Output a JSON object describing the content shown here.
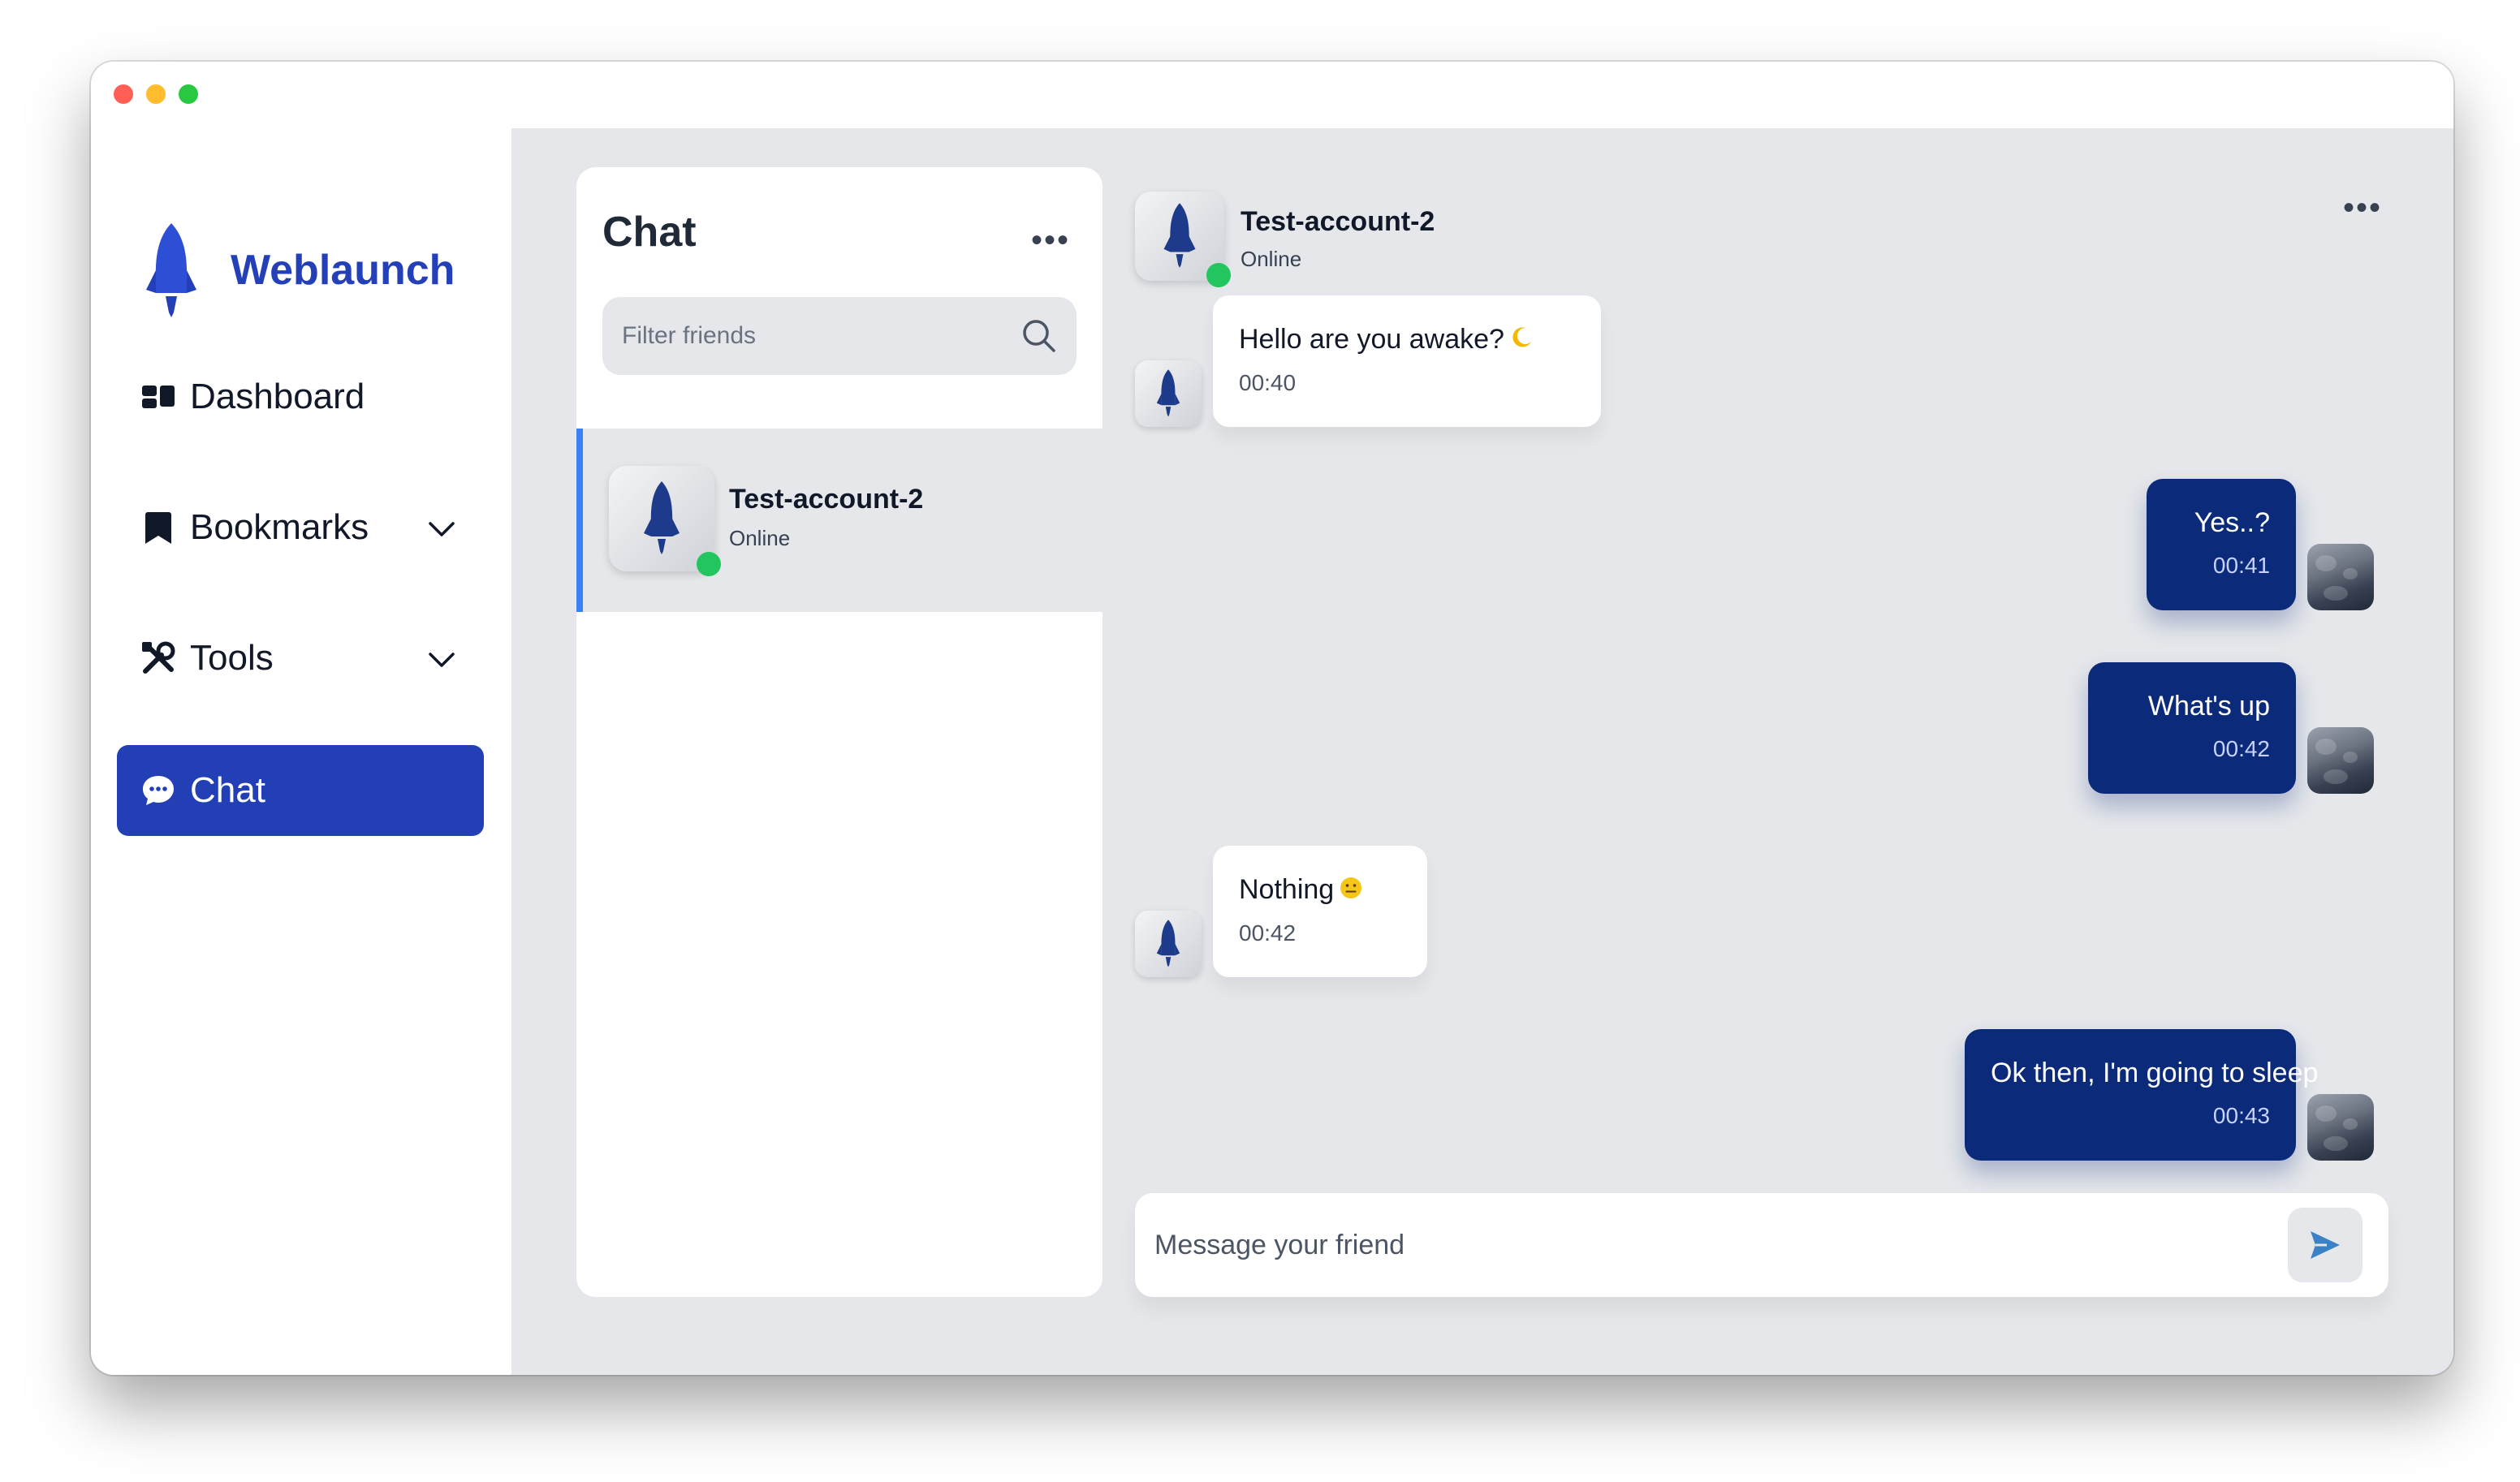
{
  "brand": {
    "name": "Weblaunch",
    "accent": "#2340b8"
  },
  "nav": {
    "items": [
      {
        "label": "Dashboard",
        "icon": "dashboard-icon"
      },
      {
        "label": "Bookmarks",
        "icon": "bookmark-icon",
        "expandable": true
      },
      {
        "label": "Tools",
        "icon": "tools-icon",
        "expandable": true
      },
      {
        "label": "Chat",
        "icon": "chat-bubble-icon",
        "active": true
      }
    ]
  },
  "friends_panel": {
    "title": "Chat",
    "more_icon": "ellipsis-icon",
    "search": {
      "placeholder": "Filter friends",
      "value": "",
      "icon": "search-icon"
    },
    "friends": [
      {
        "name": "Test-account-2",
        "status": "Online",
        "online": true,
        "selected": true
      }
    ]
  },
  "conversation": {
    "header": {
      "name": "Test-account-2",
      "status": "Online",
      "more_icon": "ellipsis-icon"
    },
    "messages": [
      {
        "direction": "incoming",
        "text": "Hello are you awake?",
        "emoji": "crescent-moon-icon",
        "time": "00:40"
      },
      {
        "direction": "outgoing",
        "text": "Yes..?",
        "time": "00:41"
      },
      {
        "direction": "outgoing",
        "text": "What's up",
        "time": "00:42"
      },
      {
        "direction": "incoming",
        "text": "Nothing",
        "emoji": "neutral-face-icon",
        "time": "00:42"
      },
      {
        "direction": "outgoing",
        "text": "Ok then, I'm going to sleep",
        "time": "00:43"
      }
    ],
    "composer": {
      "placeholder": "Message your friend",
      "value": "",
      "send_icon": "send-icon"
    }
  },
  "colors": {
    "active_nav": "#233fb5",
    "outgoing_bubble": "#0b2a7a",
    "online": "#22c55e",
    "selection_bar": "#3b82f6",
    "main_bg": "#e5e7eb"
  }
}
